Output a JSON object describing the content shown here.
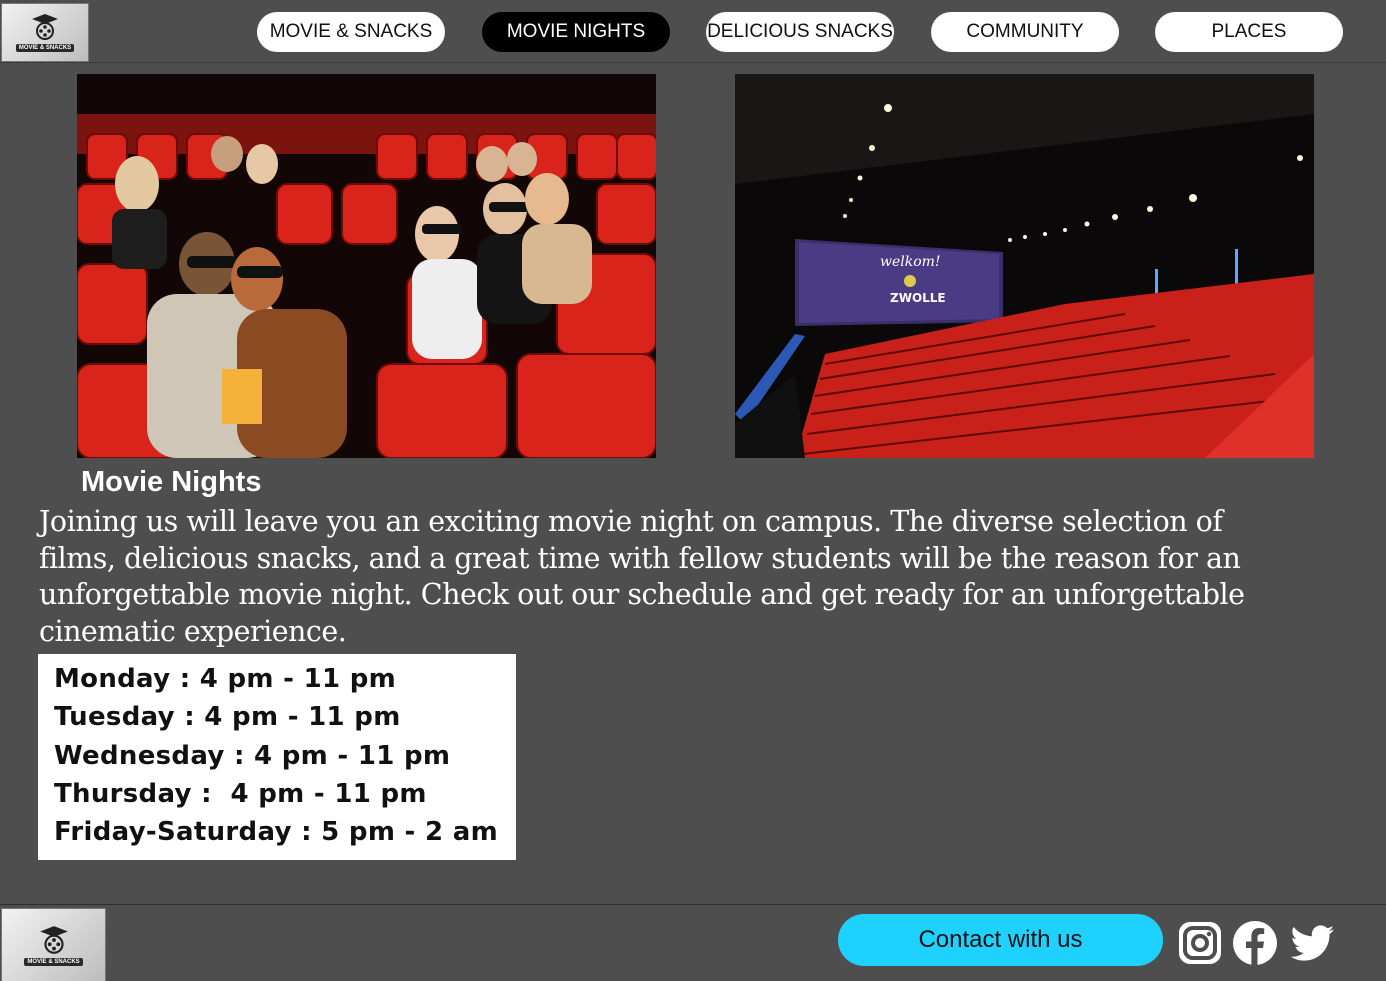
{
  "header": {
    "logo_text": "MOVIE & SNACKS",
    "nav": [
      {
        "label": "MOVIE & SNACKS",
        "active": false
      },
      {
        "label": "MOVIE NIGHTS",
        "active": true
      },
      {
        "label": "DELICIOUS SNACKS",
        "active": false
      },
      {
        "label": "COMMUNITY",
        "active": false
      },
      {
        "label": "PLACES",
        "active": false
      }
    ]
  },
  "images": {
    "left": {
      "screen_text": ""
    },
    "right": {
      "screen_text_1": "welkom!",
      "screen_text_2": "ZWOLLE"
    }
  },
  "main": {
    "title": "Movie Nights",
    "description": "Joining us will leave you an exciting movie night on campus. The diverse selection of films, delicious snacks, and a great time with fellow students will be the reason for an unforgettable movie night. Check out our schedule and get ready for an unforgettable cinematic experience.",
    "schedule": [
      "Monday : 4 pm - 11 pm",
      "Tuesday : 4 pm - 11 pm",
      "Wednesday : 4 pm - 11 pm",
      "Thursday :  4 pm - 11 pm",
      "Friday-Saturday : 5 pm - 2 am"
    ]
  },
  "footer": {
    "logo_text": "MOVIE & SNACKS",
    "contact_label": "Contact with us",
    "social": [
      "instagram-icon",
      "facebook-icon",
      "twitter-icon"
    ]
  },
  "colors": {
    "background": "#4e4e4e",
    "accent": "#1fd1ff",
    "seat_red": "#d9241b"
  }
}
